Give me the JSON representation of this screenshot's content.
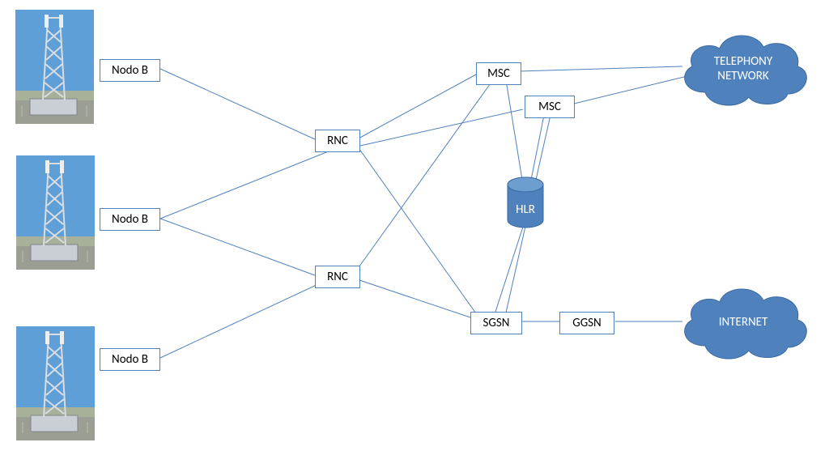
{
  "nodes": {
    "nodoB1": "Nodo B",
    "nodoB2": "Nodo B",
    "nodoB3": "Nodo B",
    "rnc1": "RNC",
    "rnc2": "RNC",
    "msc1": "MSC",
    "msc2": "MSC",
    "hlr": "HLR",
    "sgsn": "SGSN",
    "ggsn": "GGSN",
    "cloud_telephony": "TELEPHONY\nNETWORK",
    "cloud_internet": "INTERNET"
  },
  "colors": {
    "line": "#4f81bd",
    "fill": "#4f81bd",
    "cloudFill": "#4f81bd"
  }
}
